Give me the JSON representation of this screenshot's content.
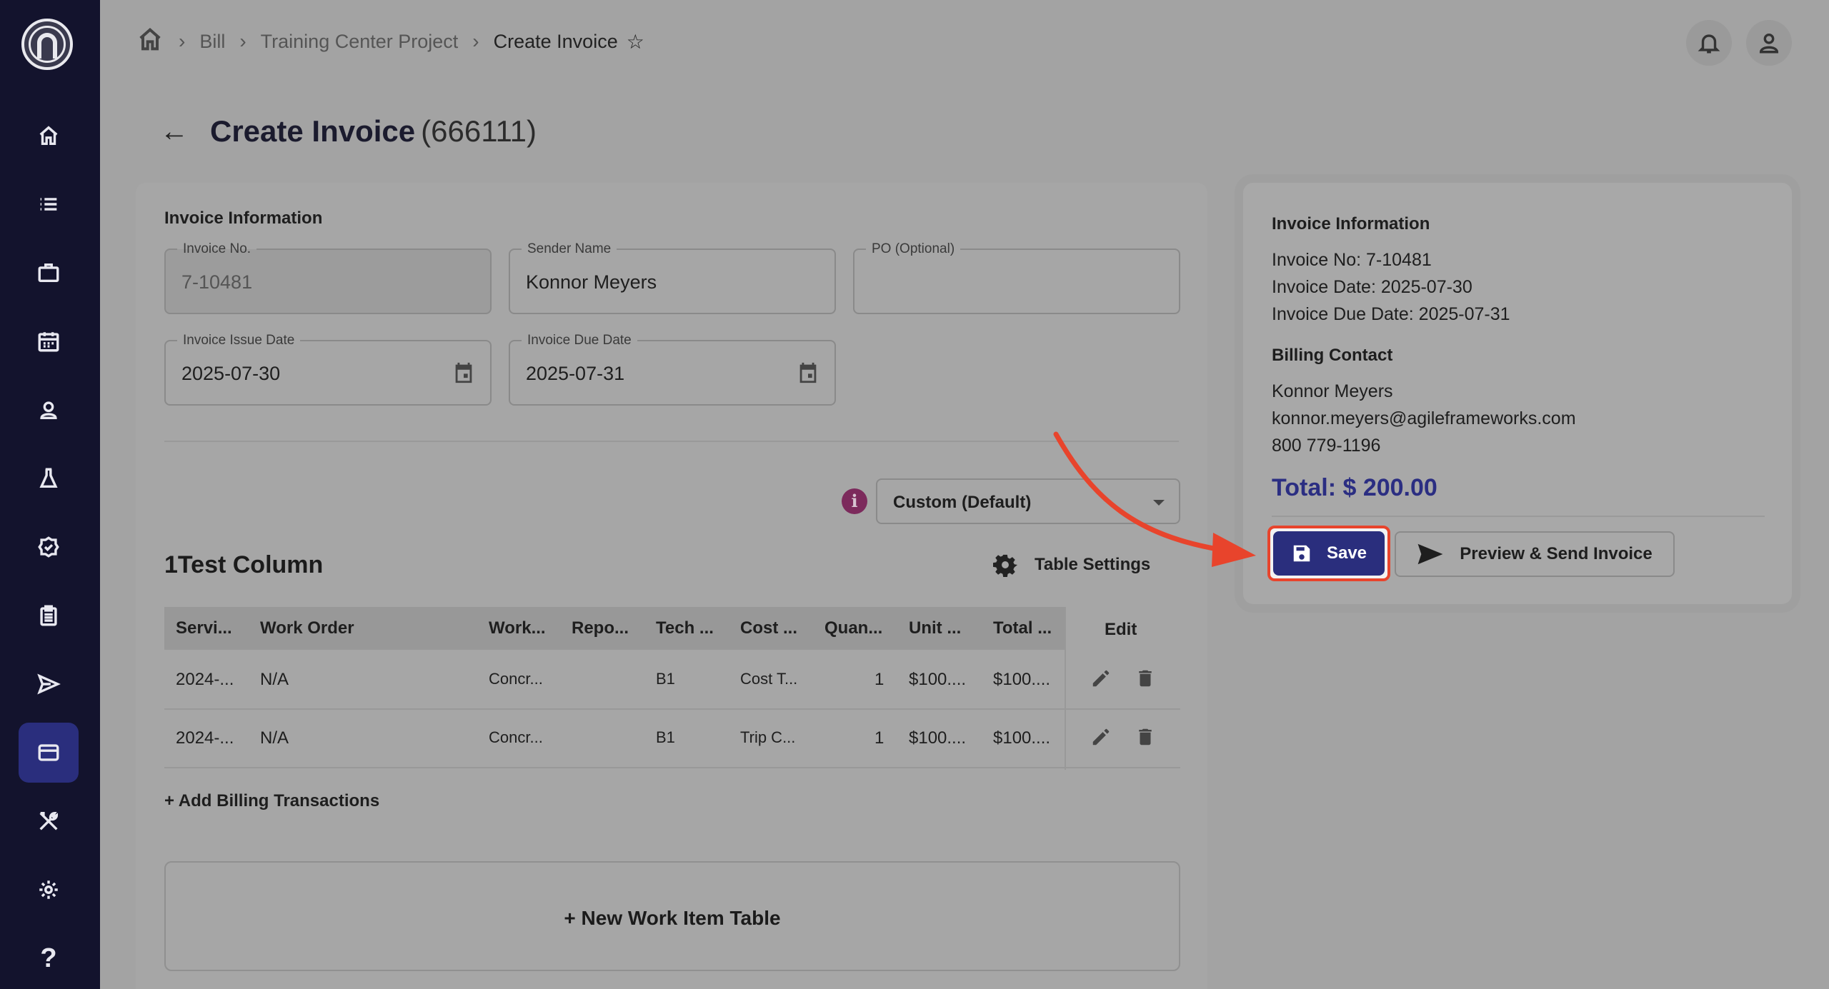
{
  "sidebar": {
    "items": [
      {
        "icon": "home-icon"
      },
      {
        "icon": "list-icon"
      },
      {
        "icon": "briefcase-icon"
      },
      {
        "icon": "calendar-icon"
      },
      {
        "icon": "person-icon"
      },
      {
        "icon": "flask-icon"
      },
      {
        "icon": "badge-check-icon"
      },
      {
        "icon": "clipboard-icon"
      },
      {
        "icon": "send-icon"
      },
      {
        "icon": "credit-card-icon",
        "active": true
      },
      {
        "icon": "tools-icon"
      },
      {
        "icon": "gear-icon"
      },
      {
        "icon": "help-icon",
        "label": "?"
      }
    ]
  },
  "breadcrumb": {
    "items": [
      "Bill",
      "Training Center Project"
    ],
    "current": "Create Invoice"
  },
  "page": {
    "title": "Create Invoice",
    "code": "(666111)"
  },
  "invoice_form": {
    "section_title": "Invoice Information",
    "invoice_no": {
      "label": "Invoice No.",
      "value": "7-10481"
    },
    "sender_name": {
      "label": "Sender Name",
      "value": "Konnor Meyers"
    },
    "po": {
      "label": "PO (Optional)",
      "value": ""
    },
    "issue_date": {
      "label": "Invoice Issue Date",
      "value": "2025-07-30"
    },
    "due_date": {
      "label": "Invoice Due Date",
      "value": "2025-07-31"
    },
    "template_select": "Custom (Default)"
  },
  "table": {
    "title": "1Test Column",
    "settings_label": "Table Settings",
    "columns": [
      "Servi...",
      "Work Order",
      "Work...",
      "Repo...",
      "Tech ...",
      "Cost ...",
      "Quan...",
      "Unit ...",
      "Total ...",
      "Edit"
    ],
    "rows": [
      {
        "service": "2024-...",
        "work_order": "N/A",
        "work": "Concr...",
        "report": "",
        "tech": "B1",
        "cost": "Cost T...",
        "quantity": "1",
        "unit": "$100....",
        "total": "$100...."
      },
      {
        "service": "2024-...",
        "work_order": "N/A",
        "work": "Concr...",
        "report": "",
        "tech": "B1",
        "cost": "Trip C...",
        "quantity": "1",
        "unit": "$100....",
        "total": "$100...."
      }
    ],
    "add_billing": "+ Add Billing Transactions",
    "new_table": "+ New Work Item Table"
  },
  "summary": {
    "section_title": "Invoice Information",
    "invoice_no": "Invoice No: 7-10481",
    "invoice_date": "Invoice Date: 2025-07-30",
    "due_date": "Invoice Due Date: 2025-07-31",
    "billing_title": "Billing Contact",
    "contact_name": "Konnor Meyers",
    "contact_email": "konnor.meyers@agileframeworks.com",
    "contact_phone": "800 779-1196",
    "total": "Total: $ 200.00",
    "save_label": "Save",
    "preview_label": "Preview & Send Invoice"
  },
  "colors": {
    "accent": "#2a2e7d",
    "sidebar": "#13132d",
    "annotation": "#e8442c"
  }
}
